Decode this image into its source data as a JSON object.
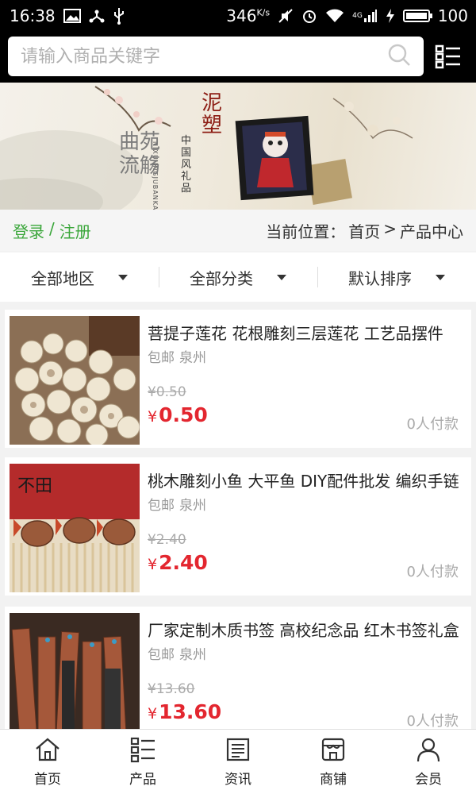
{
  "status_bar": {
    "time": "16:38",
    "speed": "346",
    "speed_unit": "K/s",
    "network": "4G",
    "battery": "100",
    "battery_fill": 1.0,
    "icons": [
      "image-icon",
      "usb-share-icon",
      "usb-icon",
      "mute-icon",
      "alarm-icon",
      "wifi-icon",
      "signal-icon",
      "charging-icon",
      "battery-icon"
    ]
  },
  "search": {
    "placeholder": "请输入商品关键字",
    "value": ""
  },
  "banner": {
    "text_left": "曲苑流觞",
    "title": "泥塑",
    "subtitle": "中国风礼品",
    "tagline": "NIXUJINGJUBANKA"
  },
  "breadcrumb_row": {
    "login": "登录",
    "separator": "/",
    "register": "注册",
    "location_label": "当前位置：",
    "home": "首页",
    "arrow": ">",
    "current": "产品中心"
  },
  "filters": [
    {
      "label": "全部地区"
    },
    {
      "label": "全部分类"
    },
    {
      "label": "默认排序"
    }
  ],
  "products": [
    {
      "title": "菩提子莲花 花根雕刻三层莲花 工艺品摆件",
      "shipping": "包邮",
      "city": "泉州",
      "old_price": "¥0.50",
      "currency": "¥",
      "price": "0.50",
      "buyers": "0人付款"
    },
    {
      "title": "桃木雕刻小鱼 大平鱼 DIY配件批发 编织手链",
      "shipping": "包邮",
      "city": "泉州",
      "old_price": "¥2.40",
      "currency": "¥",
      "price": "2.40",
      "buyers": "0人付款"
    },
    {
      "title": "厂家定制木质书签 高校纪念品 红木书签礼盒",
      "shipping": "包邮",
      "city": "泉州",
      "old_price": "¥13.60",
      "currency": "¥",
      "price": "13.60",
      "buyers": "0人付款"
    }
  ],
  "bottom_nav": [
    {
      "label": "首页",
      "icon": "home-icon"
    },
    {
      "label": "产品",
      "icon": "product-list-icon"
    },
    {
      "label": "资讯",
      "icon": "news-icon"
    },
    {
      "label": "商铺",
      "icon": "store-icon"
    },
    {
      "label": "会员",
      "icon": "user-icon"
    }
  ],
  "colors": {
    "accent_green": "#3aa63a",
    "price_red": "#e3262f",
    "header_bg": "#000000"
  }
}
